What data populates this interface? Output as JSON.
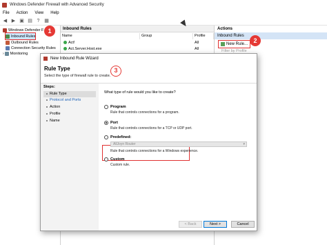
{
  "window": {
    "title": "Windows Defender Firewall with Advanced Security"
  },
  "menu": [
    "File",
    "Action",
    "View",
    "Help"
  ],
  "tree": {
    "items": [
      {
        "label": "Windows Defender F"
      },
      {
        "label": "Inbound Rules"
      },
      {
        "label": "Outbound Rules"
      },
      {
        "label": "Connection Security Rules"
      },
      {
        "label": "Monitoring"
      }
    ]
  },
  "rules_list": {
    "header": "Inbound Rules",
    "columns": [
      "Name",
      "Group",
      "Profile"
    ],
    "rows": [
      {
        "name": "Act!",
        "profile": "All"
      },
      {
        "name": "Act.Server.Host.exe",
        "profile": "All"
      }
    ]
  },
  "actions": {
    "title": "Actions",
    "section": "Inbound Rules",
    "new_rule": "New Rule...",
    "filter_by_profile": "Filter by Profile"
  },
  "wizard": {
    "title": "New Inbound Rule Wizard",
    "heading": "Rule Type",
    "subtitle": "Select the type of firewall rule to create.",
    "steps_title": "Steps:",
    "steps": [
      "Rule Type",
      "Protocol and Ports",
      "Action",
      "Profile",
      "Name"
    ],
    "question": "What type of rule would you like to create?",
    "options": [
      {
        "label": "Program",
        "desc": "Rule that controls connections for a program.",
        "selected": false
      },
      {
        "label": "Port",
        "desc": "Rule that controls connections for a TCP or UDP port.",
        "selected": true
      },
      {
        "label": "Predefined:",
        "desc": "",
        "selected": false
      },
      {
        "label": "Custom",
        "desc": "Custom rule.",
        "selected": false
      }
    ],
    "predefined_value": "AllJoyn Router",
    "predefined_desc": "Rule that controls connections for a Windows experience.",
    "buttons": {
      "back": "< Back",
      "next": "Next >",
      "cancel": "Cancel"
    }
  },
  "badges": [
    "1",
    "2",
    "3"
  ]
}
